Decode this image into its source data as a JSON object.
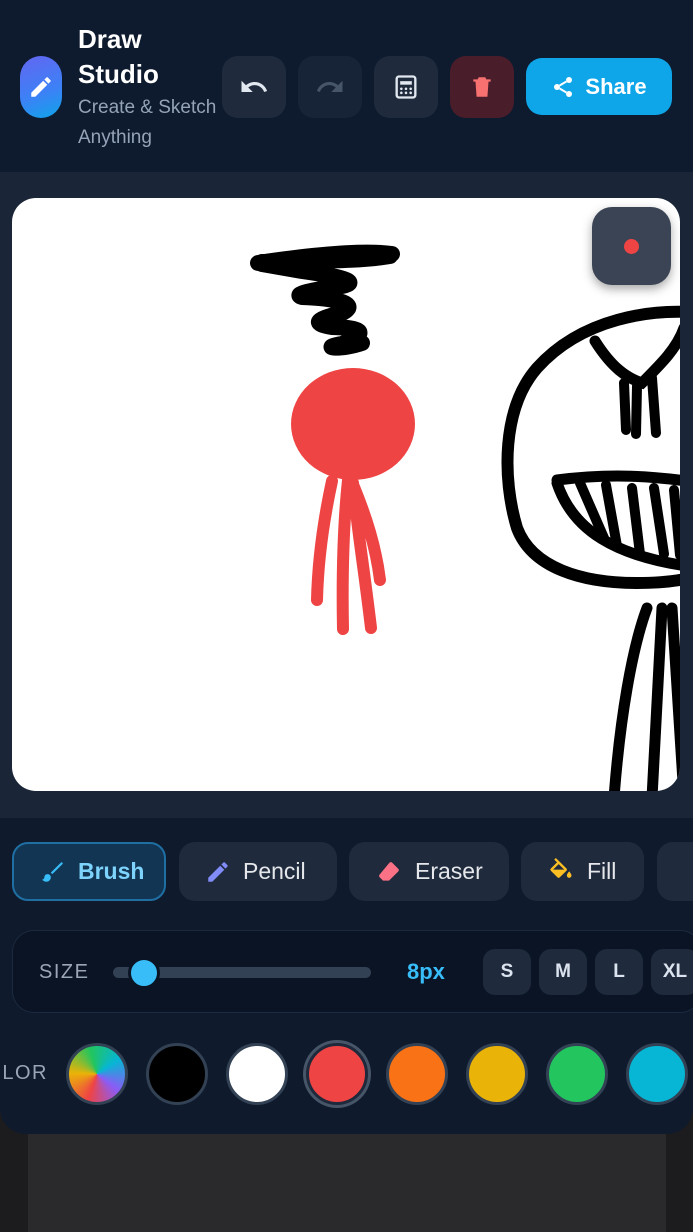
{
  "app": {
    "title": "Draw Studio",
    "subtitle": "Create & Sketch Anything"
  },
  "toolbar": {
    "share_label": "Share",
    "buttons": [
      "undo-icon",
      "redo-icon",
      "grid-icon",
      "trash-icon",
      "share-icon"
    ]
  },
  "tools": [
    {
      "label": "Brush",
      "icon": "brush-icon",
      "active": true
    },
    {
      "label": "Pencil",
      "icon": "pencil-icon",
      "active": false
    },
    {
      "label": "Eraser",
      "icon": "eraser-icon",
      "active": false
    },
    {
      "label": "Fill",
      "icon": "fill-bucket-icon",
      "active": false
    }
  ],
  "size": {
    "label": "SIZE",
    "value": "8px",
    "slider_fraction": 0.12,
    "presets": [
      "S",
      "M",
      "L",
      "XL"
    ]
  },
  "colors": {
    "label": "COLOR",
    "swatches": [
      "rainbow",
      "#000000",
      "#ffffff",
      "#ef4444",
      "#f97316",
      "#eab308",
      "#22c55e",
      "#06b6d4"
    ],
    "selected": "#ef4444"
  },
  "theme": {
    "accent": "#0ea5e9",
    "brush_color": "#ef4444"
  }
}
